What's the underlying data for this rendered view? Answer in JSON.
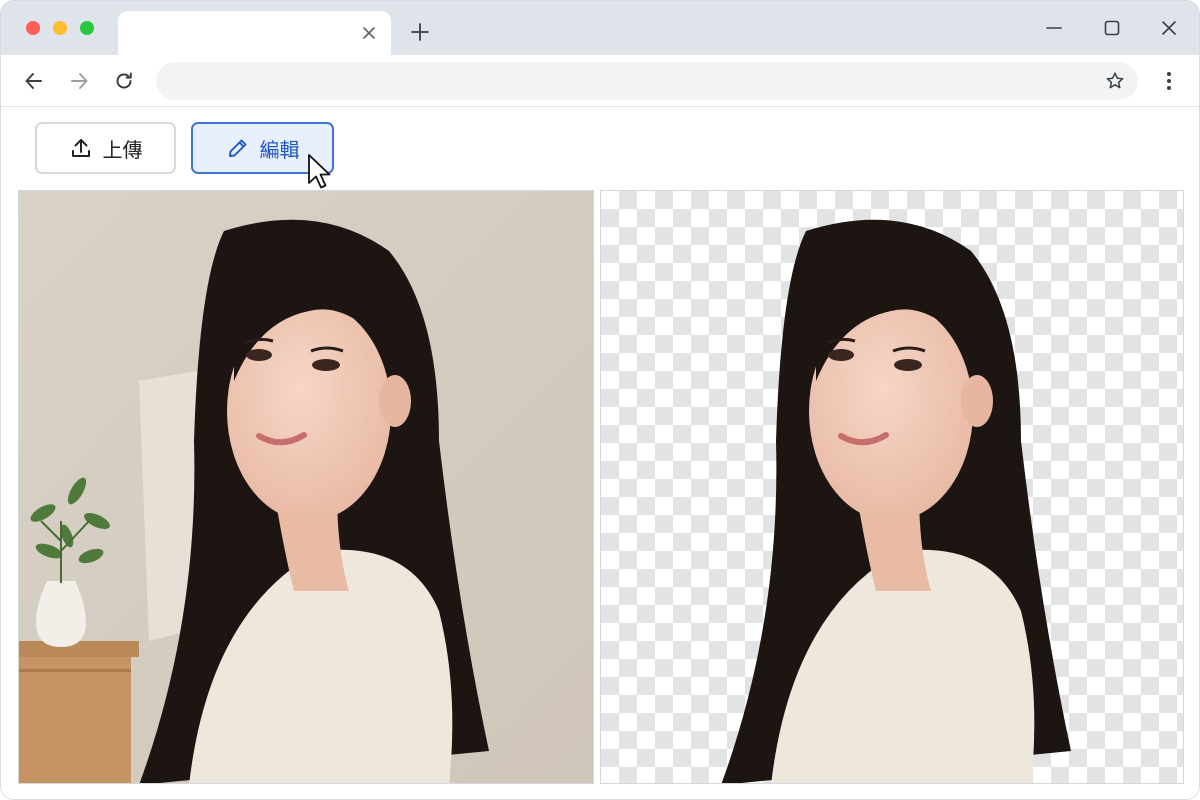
{
  "browser": {
    "tab_title": "",
    "address": "",
    "icons": {
      "tab_close": "close-icon",
      "new_tab": "plus-icon",
      "minimize": "minimize-icon",
      "maximize": "maximize-icon",
      "window_close": "close-icon",
      "back": "arrow-left-icon",
      "forward": "arrow-right-icon",
      "reload": "reload-icon",
      "bookmark": "star-icon",
      "menu": "more-vertical-icon"
    }
  },
  "toolbar": {
    "upload_label": "上傳",
    "upload_icon": "upload-icon",
    "edit_label": "編輯",
    "edit_icon": "pencil-icon"
  },
  "images": {
    "original": "portrait-photo",
    "result": "portrait-background-removed"
  },
  "colors": {
    "accent": "#3b73d6",
    "accent_bg": "#e8f0fe",
    "titlebar": "#dfe3ea"
  }
}
